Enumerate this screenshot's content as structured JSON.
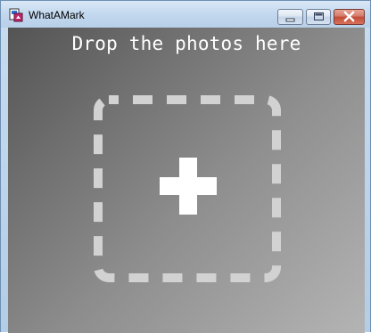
{
  "window": {
    "title": "WhatAMark",
    "app_icon": "whatamark-app-icon",
    "controls": {
      "minimize_icon": "minimize-icon",
      "maximize_icon": "maximize-icon",
      "close_icon": "close-icon"
    }
  },
  "main": {
    "drop_label": "Drop the photos here",
    "drop_icon": "plus-icon",
    "colors": {
      "gradient_dark": "#545454",
      "gradient_light": "#b4b4b4",
      "dashed_border": "#d2d2d2",
      "plus": "#ffffff"
    }
  }
}
